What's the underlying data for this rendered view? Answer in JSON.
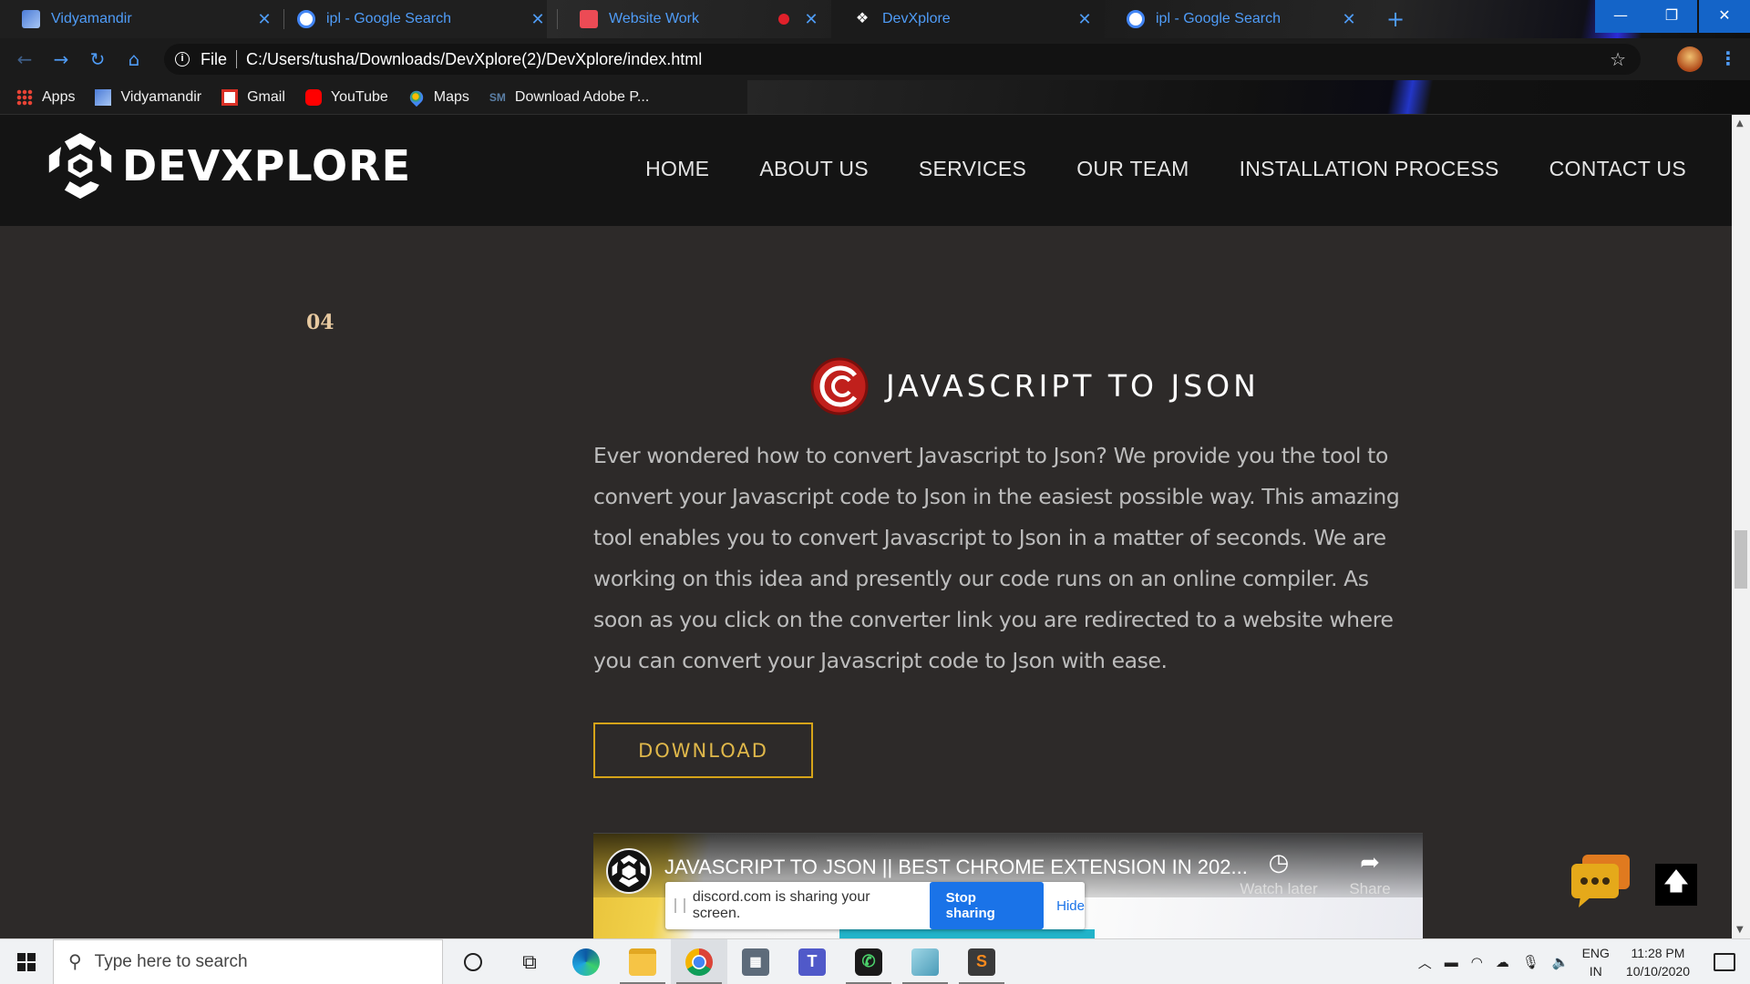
{
  "browser": {
    "tabs": [
      {
        "title": "Vidyamandir",
        "favicon": "vidyamandir-favicon",
        "active": false
      },
      {
        "title": "ipl - Google Search",
        "favicon": "google-favicon",
        "active": false
      },
      {
        "title": "Website Work",
        "favicon": "website-work-favicon",
        "active": false,
        "recording": true
      },
      {
        "title": "DevXplore",
        "favicon": "devxplore-favicon",
        "active": true
      },
      {
        "title": "ipl - Google Search",
        "favicon": "google-favicon",
        "active": false
      }
    ],
    "new_tab": "+",
    "window_controls": {
      "minimize": "—",
      "restore": "❐",
      "close": "✕"
    },
    "address": {
      "scheme": "File",
      "url": "C:/Users/tusha/Downloads/DevXplore(2)/DevXplore/index.html"
    },
    "bookmarks": [
      {
        "label": "Apps",
        "icon": "apps-grid-icon"
      },
      {
        "label": "Vidyamandir",
        "icon": "vidyamandir-icon"
      },
      {
        "label": "Gmail",
        "icon": "gmail-icon"
      },
      {
        "label": "YouTube",
        "icon": "youtube-icon"
      },
      {
        "label": "Maps",
        "icon": "maps-icon"
      },
      {
        "label": "Download Adobe P...",
        "icon": "sm-icon",
        "icon_text": "SM"
      }
    ],
    "accent_color": "#4f9cf7"
  },
  "site": {
    "logo_text": "DEVXPLORE",
    "nav": [
      "HOME",
      "ABOUT US",
      "SERVICES",
      "OUR TEAM",
      "INSTALLATION PROCESS",
      "CONTACT US"
    ],
    "step_number": "04",
    "service": {
      "title": "JAVASCRIPT TO JSON",
      "description": "Ever wondered how to convert Javascript to Json? We provide you the tool to convert your Javascript code to Json in the easiest possible way. This amazing tool enables you to convert Javascript to Json in a matter of seconds. We are working on this idea and presently our code runs on an online compiler. As soon as you click on the converter link you are redirected to a website where you can convert your Javascript code to Json with ease.",
      "button": "DOWNLOAD"
    },
    "video": {
      "title": "JAVASCRIPT TO JSON || BEST CHROME EXTENSION IN 202...",
      "watch_later": "Watch later",
      "share": "Share"
    },
    "colors": {
      "header_bg": "#141414",
      "page_bg": "#2d2a29",
      "button_border": "#d6a419",
      "step_color": "#e7c9a0"
    }
  },
  "screen_share": {
    "message": "discord.com is sharing your screen.",
    "stop": "Stop sharing",
    "hide": "Hide"
  },
  "taskbar": {
    "search_placeholder": "Type here to search",
    "apps": [
      "cortana-icon",
      "task-view-icon",
      "edge-icon",
      "file-explorer-icon",
      "chrome-icon",
      "calculator-icon",
      "teams-icon",
      "whatsapp-icon",
      "notepad-icon",
      "sublime-icon"
    ],
    "language": {
      "line1": "ENG",
      "line2": "IN"
    },
    "clock": {
      "time": "11:28 PM",
      "date": "10/10/2020"
    }
  }
}
